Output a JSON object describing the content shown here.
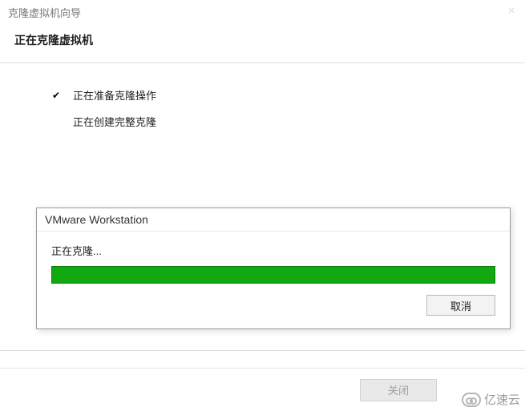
{
  "window": {
    "title": "克隆虚拟机向导",
    "heading": "正在克隆虚拟机"
  },
  "steps": {
    "prepare": "正在准备克隆操作",
    "create": "正在创建完整克隆"
  },
  "dialog": {
    "title": "VMware Workstation",
    "status": "正在克隆...",
    "progress_percent": 100,
    "cancel_label": "取消"
  },
  "footer": {
    "close_label": "关闭"
  },
  "watermark": {
    "text": "亿速云"
  },
  "icons": {
    "check": "✔",
    "close_x": "×"
  }
}
